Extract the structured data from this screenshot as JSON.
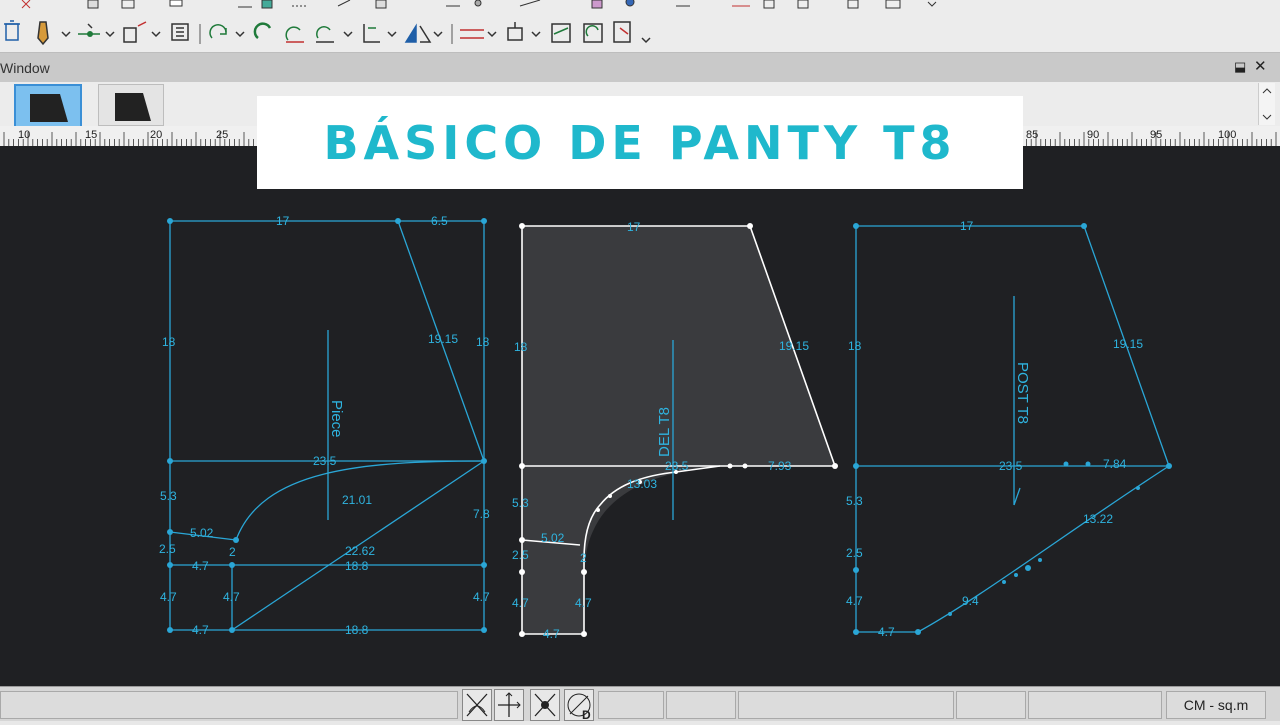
{
  "window": {
    "title": "Window",
    "pin_icon": "pin-icon",
    "close_icon": "close-icon"
  },
  "banner": {
    "title": "BÁSICO DE PANTY T8"
  },
  "ruler": {
    "labels": [
      "10",
      "15",
      "20",
      "25",
      "85",
      "90",
      "95",
      "100"
    ]
  },
  "status": {
    "units": "CM - sq.m"
  },
  "colors": {
    "line_blue": "#2aa6d6",
    "label_blue": "#2fb4e0",
    "piece_fill": "#3a3b3e",
    "white_line": "#ffffff",
    "banner_text": "#1fb8cc"
  },
  "draft": {
    "left": {
      "piece_label": "Piece",
      "measures": [
        "17",
        "6.5",
        "18",
        "19.15",
        "18",
        "23.5",
        "5.3",
        "21.01",
        "7.8",
        "5.02",
        "2",
        "22.62",
        "2.5",
        "4.7",
        "18.8",
        "4.7",
        "4.7",
        "4.7",
        "4.7",
        "18.8"
      ]
    },
    "middle": {
      "piece_label": "DEL T8",
      "measures": [
        "17",
        "18",
        "19.15",
        "23.5",
        "7.93",
        "13.03",
        "5.3",
        "5.02",
        "2.5",
        "2",
        "4.7",
        "4.7",
        "4.7"
      ]
    },
    "right": {
      "piece_label": "POST T8",
      "measures": [
        "17",
        "18",
        "19.15",
        "23.5",
        "7.84",
        "5.3",
        "13.22",
        "2.5",
        "9.4",
        "4.7",
        "4.7"
      ]
    }
  }
}
